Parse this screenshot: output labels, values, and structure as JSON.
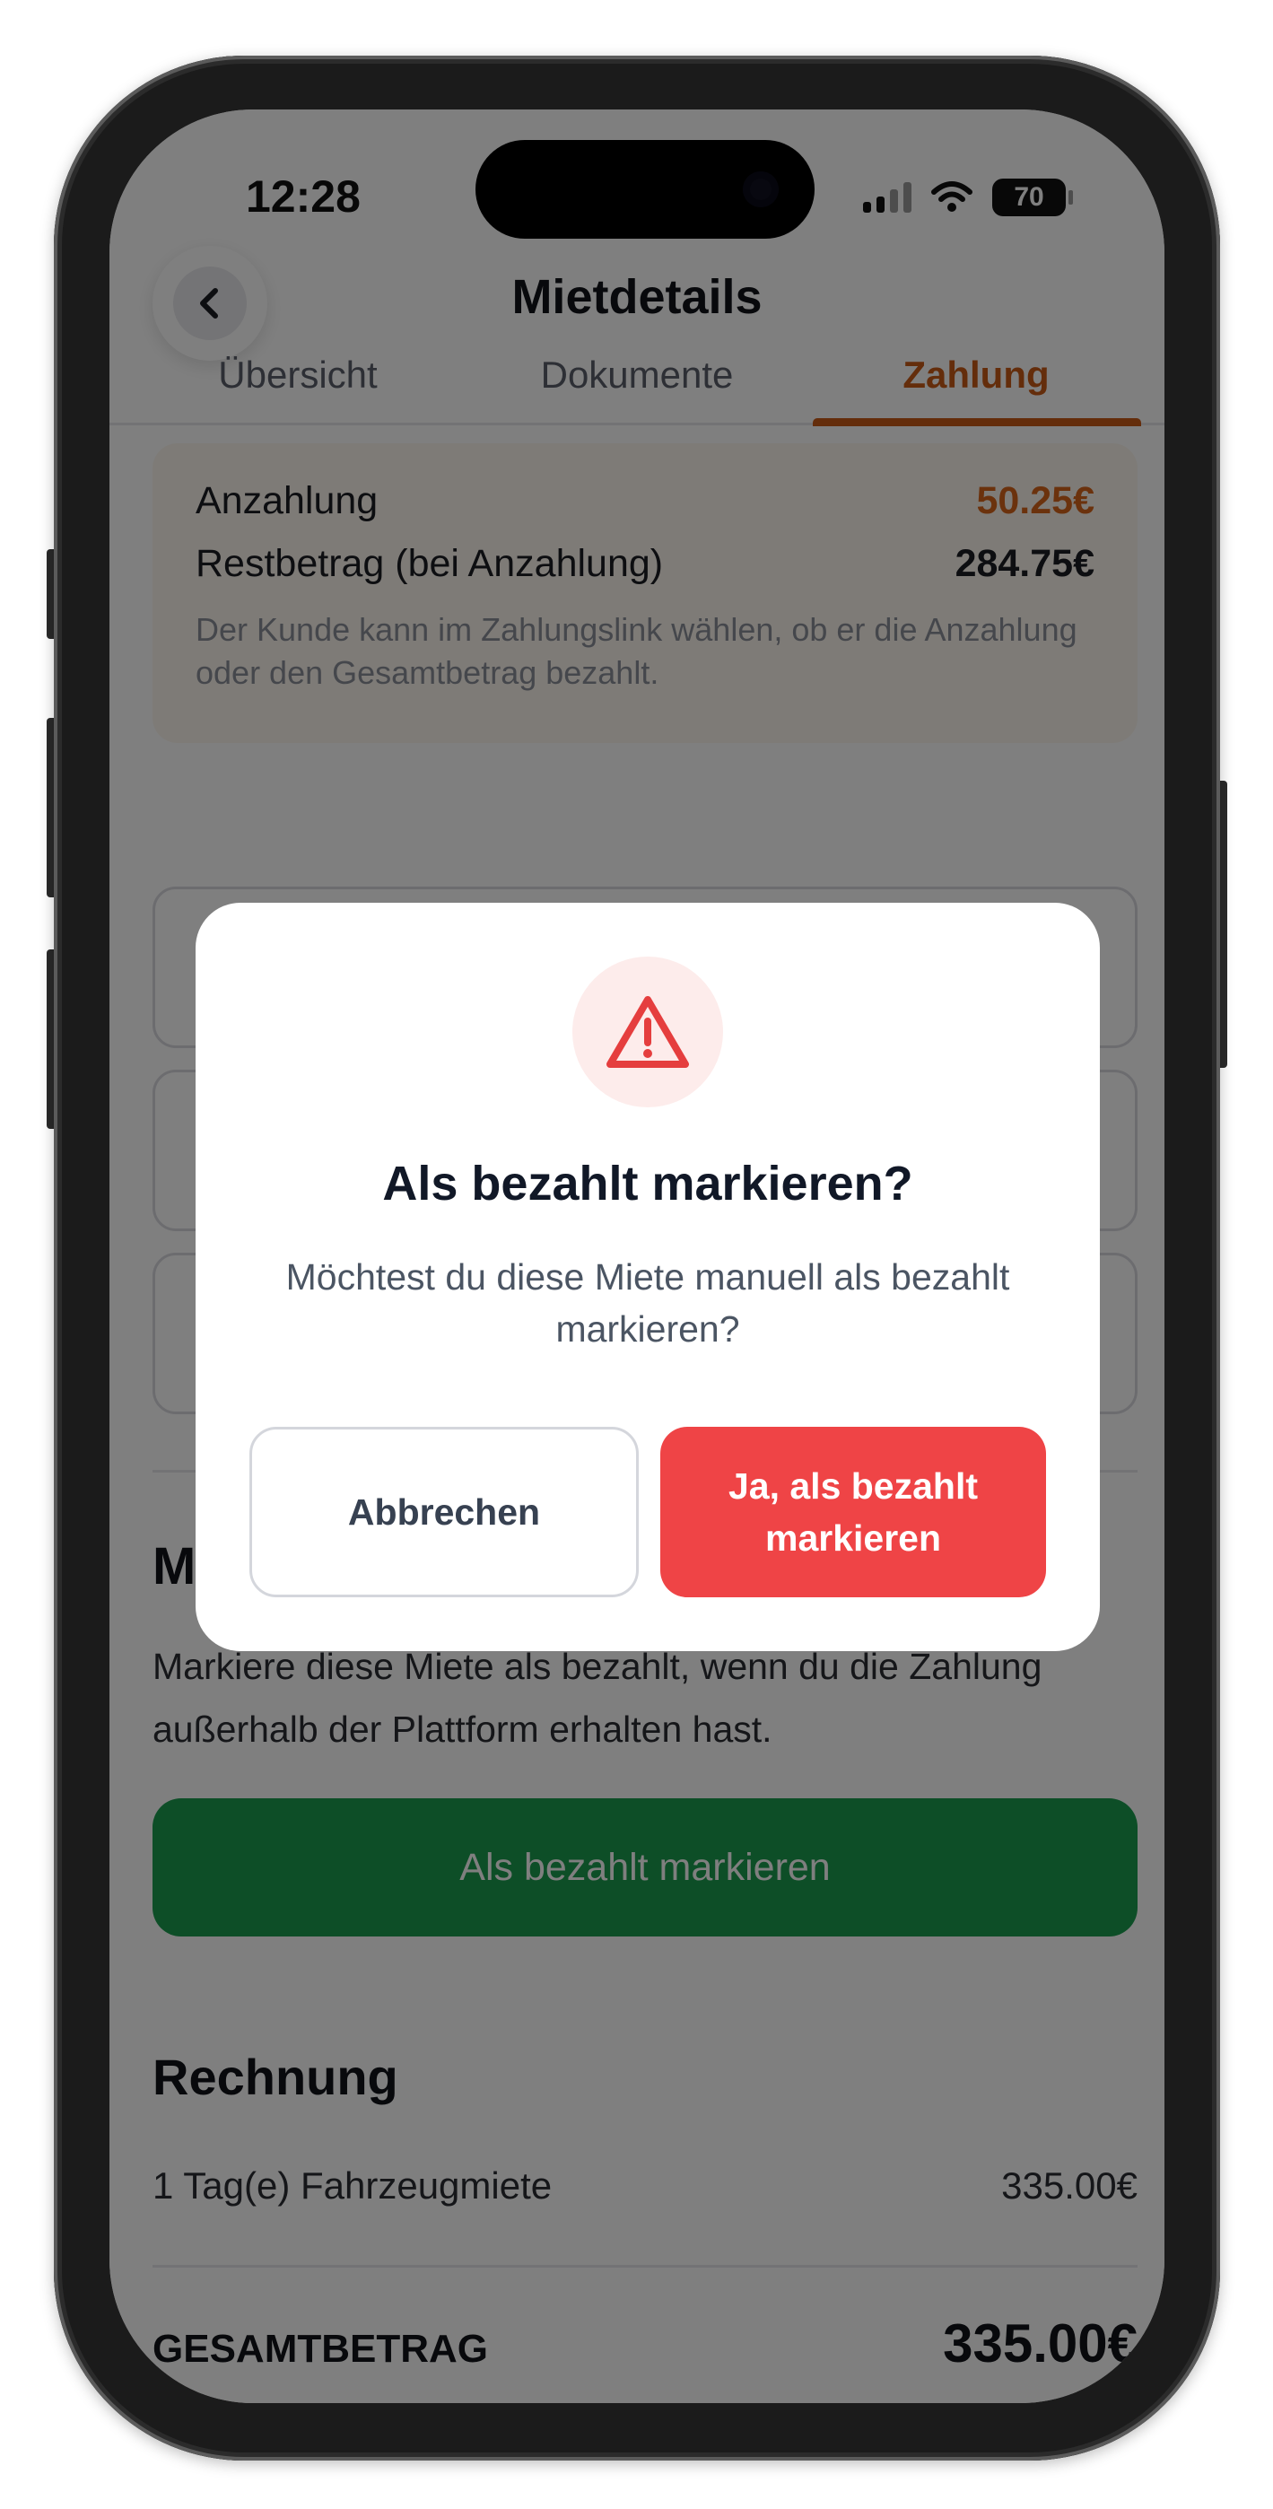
{
  "status_bar": {
    "time": "12:28",
    "battery": "70",
    "signal_icon": "cellular-signal-icon",
    "wifi_icon": "wifi-icon",
    "battery_icon": "battery-icon"
  },
  "header": {
    "title": "Mietdetails",
    "back_icon": "chevron-left-icon"
  },
  "tabs": [
    {
      "label": "Übersicht",
      "active": false
    },
    {
      "label": "Dokumente",
      "active": false
    },
    {
      "label": "Zahlung",
      "active": true
    }
  ],
  "payment": {
    "deposit_label": "Anzahlung",
    "deposit_value": "50.25€",
    "remaining_label": "Restbetrag (bei Anzahlung)",
    "remaining_value": "284.75€",
    "note": "Der Kunde kann im Zahlungslink wählen, ob er die Anzahlung oder den Gesamtbetrag bezahlt."
  },
  "mark_paid": {
    "title_visible": "M",
    "description": "Markiere diese Miete als bezahlt, wenn du die Zahlung außerhalb der Plattform erhalten hast.",
    "button_label": "Als bezahlt markieren"
  },
  "invoice": {
    "title": "Rechnung",
    "items": [
      {
        "label": "1 Tag(e) Fahrzeugmiete",
        "amount": "335.00€"
      }
    ],
    "total_label": "GESAMTBETRAG",
    "total_value": "335.00€"
  },
  "modal": {
    "icon": "warning-icon",
    "title": "Als bezahlt markieren?",
    "message": "Möchtest du diese Miete manuell als bezahlt markieren?",
    "cancel_label": "Abbrechen",
    "confirm_label": "Ja, als bezahlt markieren"
  },
  "colors": {
    "accent_orange": "#c85a16",
    "confirm_red": "#ef4446",
    "mark_button_green": "#1a9c4f",
    "overlay": "rgba(0,0,0,0.5)"
  }
}
